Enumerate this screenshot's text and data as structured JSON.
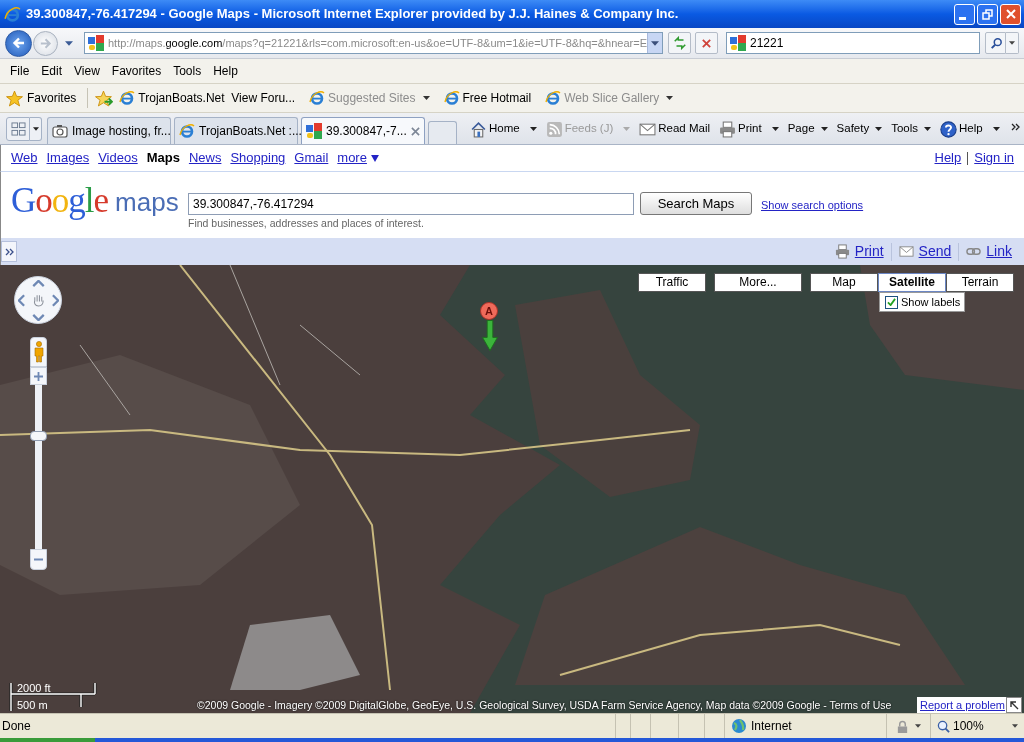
{
  "window": {
    "title": "39.300847,-76.417294 - Google Maps - Microsoft Internet Explorer provided by J.J. Haines & Company Inc."
  },
  "address_bar": {
    "url": {
      "prefix": "http://maps.",
      "domain": "google.com",
      "path": "/maps?q=21221&rls=com.microsoft:en-us&oe=UTF-8&um=1&ie=UTF-8&hq=&hnear=E"
    },
    "search_value": "21221"
  },
  "menu_bar": [
    "File",
    "Edit",
    "View",
    "Favorites",
    "Tools",
    "Help"
  ],
  "favorites_bar": {
    "label": "Favorites",
    "items": [
      {
        "label": "TrojanBoats.Net  View Foru...",
        "disabled": false,
        "dropdown": false
      },
      {
        "label": "Suggested Sites",
        "disabled": true,
        "dropdown": true
      },
      {
        "label": "Free Hotmail",
        "disabled": false,
        "dropdown": false
      },
      {
        "label": "Web Slice Gallery",
        "disabled": true,
        "dropdown": true
      }
    ]
  },
  "tabs": [
    {
      "label": "Image hosting, fr...",
      "kind": "camera",
      "selected": false
    },
    {
      "label": "TrojanBoats.Net :...",
      "kind": "browser",
      "selected": false
    },
    {
      "label": "39.300847,-7...",
      "kind": "google",
      "selected": true
    }
  ],
  "command_bar": [
    {
      "label": "Home",
      "kind": "home",
      "dropdown": true,
      "disabled": false
    },
    {
      "label": "Feeds (J)",
      "kind": "feed",
      "dropdown": true,
      "disabled": true
    },
    {
      "label": "Read Mail",
      "kind": "mail",
      "dropdown": false,
      "disabled": false
    },
    {
      "label": "Print",
      "kind": "print",
      "dropdown": true,
      "disabled": false
    },
    {
      "label": "Page",
      "kind": "text",
      "dropdown": true,
      "disabled": false
    },
    {
      "label": "Safety",
      "kind": "text",
      "dropdown": true,
      "disabled": false
    },
    {
      "label": "Tools",
      "kind": "text",
      "dropdown": true,
      "disabled": false
    },
    {
      "label": "Help",
      "kind": "help",
      "dropdown": true,
      "disabled": false
    }
  ],
  "google_bar": {
    "links": [
      {
        "label": "Web",
        "selected": false,
        "dropdown": false
      },
      {
        "label": "Images",
        "selected": false,
        "dropdown": false
      },
      {
        "label": "Videos",
        "selected": false,
        "dropdown": false
      },
      {
        "label": "Maps",
        "selected": true,
        "dropdown": false
      },
      {
        "label": "News",
        "selected": false,
        "dropdown": false
      },
      {
        "label": "Shopping",
        "selected": false,
        "dropdown": false
      },
      {
        "label": "Gmail",
        "selected": false,
        "dropdown": false
      },
      {
        "label": "more",
        "selected": false,
        "dropdown": true
      }
    ],
    "account_links": [
      "Help",
      "Sign in"
    ]
  },
  "search": {
    "logo": "Google",
    "product": "maps",
    "value": "39.300847,-76.417294",
    "hint": "Find businesses, addresses and places of interest.",
    "button": "Search Maps",
    "options_link": "Show search options"
  },
  "action_bar": {
    "links": [
      {
        "label": "Print",
        "kind": "print"
      },
      {
        "label": "Send",
        "kind": "mail"
      },
      {
        "label": "Link",
        "kind": "link"
      }
    ]
  },
  "map": {
    "layers": [
      "Traffic",
      "More..."
    ],
    "map_types": [
      {
        "label": "Map",
        "selected": false
      },
      {
        "label": "Satellite",
        "selected": true
      },
      {
        "label": "Terrain",
        "selected": false
      }
    ],
    "show_labels": {
      "label": "Show labels",
      "checked": true
    },
    "zoom": {
      "level": 0.7
    },
    "marker": {
      "label": "A"
    },
    "scale": {
      "imperial": "2000 ft",
      "metric": "500 m"
    },
    "copyright": "©2009 Google - Imagery ©2009 DigitalGlobe, GeoEye, U.S. Geological Survey, USDA Farm Service Agency, Map data ©2009 Google - Terms of Use",
    "report_link": "Report a problem"
  },
  "status_bar": {
    "text": "Done",
    "zone": "Internet",
    "zoom": "100%"
  }
}
